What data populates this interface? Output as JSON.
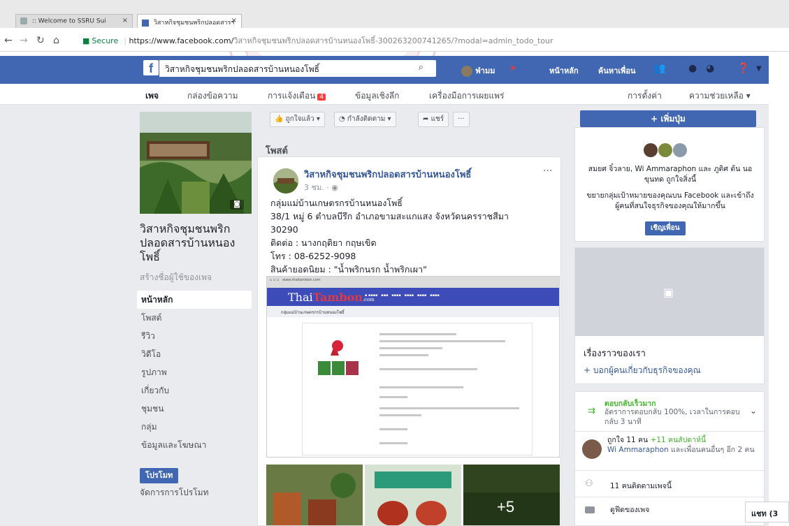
{
  "browser": {
    "tabs": [
      {
        "title": ":: Welcome to SSRU Sui"
      },
      {
        "title": "วิสาหกิจชุมชนพริกปลอดสารฯ"
      }
    ],
    "secure_label": "Secure",
    "url_host": "https://www.facebook.com/",
    "url_path": "วิสาหกิจชุมชนพริกปลอดสารบ้านหนองโพธิ์-300263200741265/?modal=admin_todo_tour"
  },
  "fb_header": {
    "logo": "f",
    "search_value": "วิสาหกิจชุมชนพริกปลอดสารบ้านหนองโพธิ์",
    "user_label": "ฟ่ามม",
    "home_label": "หน้าหลัก",
    "find_friends_label": "ค้นหาเพื่อน"
  },
  "page_tabs": {
    "page": "เพจ",
    "inbox": "กล่องข้อความ",
    "notifications": "การแจ้งเตือน",
    "notifications_count": "4",
    "insights": "ข้อมูลเชิงลึก",
    "publishing_tools": "เครื่องมือการเผยแพร่",
    "settings": "การตั้งค่า",
    "help": "ความช่วยเหลือ ▾"
  },
  "left_column": {
    "page_name": "วิสาหกิจชุมชนพริกปลอดสารบ้านหนองโพธิ์",
    "create_username": "สร้างชื่อผู้ใช้ของเพจ",
    "nav": [
      {
        "label": "หน้าหลัก"
      },
      {
        "label": "โพสต์"
      },
      {
        "label": "รีวิว"
      },
      {
        "label": "วิดีโอ"
      },
      {
        "label": "รูปภาพ"
      },
      {
        "label": "เกี่ยวกับ"
      },
      {
        "label": "ชุมชน"
      },
      {
        "label": "กลุ่ม"
      },
      {
        "label": "ข้อมูลและโฆษณา"
      }
    ],
    "promote_label": "โปรโมท",
    "manage_promotions": "จัดการการโปรโมท"
  },
  "actions": {
    "liked": "ถูกใจแล้ว ▾",
    "following": "กำลังติดตาม ▾",
    "share": "แชร์",
    "more": "···"
  },
  "posts_section_title": "โพสต์",
  "post": {
    "author": "วิสาหกิจชุมชนพริกปลอดสารบ้านหนองโพธิ์",
    "meta": "3 ชม. · ◉",
    "more": "···",
    "lines": [
      "กลุ่มแม่บ้านเกษตรกรบ้านหนองโพธิ์",
      "38/1 หมู่ 6 ตำบลบีรึก อำเภอขามสะแกแสง จังหวัดนครราชสีมา",
      "30290",
      "ติดต่อ : นางกฤติยา กฤษเขิด",
      "โทร : 08-6252-9098",
      "สินค้ายอดนิยม : \"น้ำพริกนรก น้ำพริกเผา\""
    ],
    "shared_site": {
      "logo_main": "Thai",
      "logo_accent": "Tambon",
      "logo_sub": ".com",
      "breadcrumb": "กลุ่มแม่บ้านเกษตรกรบ้านหนองโพธิ์"
    },
    "more_photos": "+5"
  },
  "right_column": {
    "add_button": "+ เพิ่มปุ่ม",
    "likers_text": "สมยศ จิ๋วลาย, Wi Ammaraphon และ ภูติศ ต้น นอขุนทด ถูกใจสิ่งนี้",
    "grow_text": "ขยายกลุ่มเป้าหมายของคุณบน Facebook และเข้าถึงผู้คนที่สนใจธุรกิจของคุณให้มากขึ้น",
    "invite_button": "เชิญเพื่อน",
    "story_title": "เรื่องราวของเรา",
    "story_link": "+ บอกผู้คนเกี่ยวกับธุรกิจของคุณ",
    "response_title": "ตอบกลับเร็วมาก",
    "response_text": "อัตราการตอบกลับ 100%, เวลาในการตอบกลับ 3 นาที",
    "likes_main": "ถูกใจ 11 คน",
    "likes_week": "+11 คนสัปดาห์นี้",
    "likes_friend": "Wi Ammaraphon",
    "likes_rest": "และเพื่อนคนอื่นๆ อีก 2 คน",
    "followers": "11 คนติดตามเพจนี้",
    "see_pages": "ดูฟีดของเพจ"
  },
  "chat": {
    "label": "แชท (3"
  },
  "colors": {
    "fb_blue": "#4267b2",
    "page_bg": "#e9ebee",
    "link": "#365899",
    "green": "#42b72a"
  }
}
